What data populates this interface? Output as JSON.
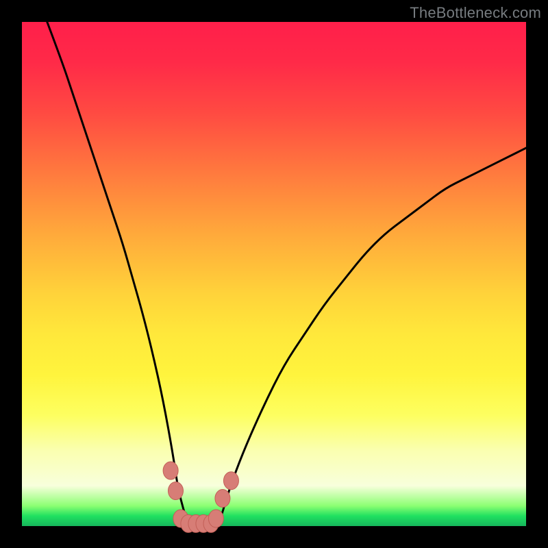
{
  "watermark": "TheBottleneck.com",
  "colors": {
    "frame": "#000000",
    "gradient_top": "#ff1f4a",
    "gradient_mid": "#ffe83b",
    "gradient_bottom": "#17b65c",
    "curve_stroke": "#000000",
    "marker_fill": "#d77d76",
    "marker_stroke": "#c25f57"
  },
  "chart_data": {
    "type": "line",
    "title": "",
    "xlabel": "",
    "ylabel": "",
    "xlim": [
      0,
      100
    ],
    "ylim": [
      0,
      100
    ],
    "grid": false,
    "series": [
      {
        "name": "bottleneck-curve",
        "x": [
          5,
          8,
          10,
          12,
          14,
          16,
          18,
          20,
          22,
          24,
          26,
          28,
          30,
          31,
          33,
          35,
          37,
          39,
          41,
          44,
          48,
          52,
          56,
          60,
          64,
          68,
          72,
          76,
          80,
          84,
          88,
          92,
          96,
          100
        ],
        "y": [
          100,
          92,
          86,
          80,
          74,
          68,
          62,
          56,
          49,
          42,
          34,
          25,
          14,
          7,
          0,
          0,
          0,
          0,
          7,
          15,
          24,
          32,
          38,
          44,
          49,
          54,
          58,
          61,
          64,
          67,
          69,
          71,
          73,
          75
        ]
      }
    ],
    "markers": [
      {
        "x": 29.5,
        "y": 11
      },
      {
        "x": 30.5,
        "y": 7
      },
      {
        "x": 31.5,
        "y": 1.5
      },
      {
        "x": 33.0,
        "y": 0.5
      },
      {
        "x": 34.5,
        "y": 0.5
      },
      {
        "x": 36.0,
        "y": 0.5
      },
      {
        "x": 37.5,
        "y": 0.5
      },
      {
        "x": 38.5,
        "y": 1.5
      },
      {
        "x": 39.8,
        "y": 5.5
      },
      {
        "x": 41.5,
        "y": 9
      }
    ],
    "annotations": []
  }
}
